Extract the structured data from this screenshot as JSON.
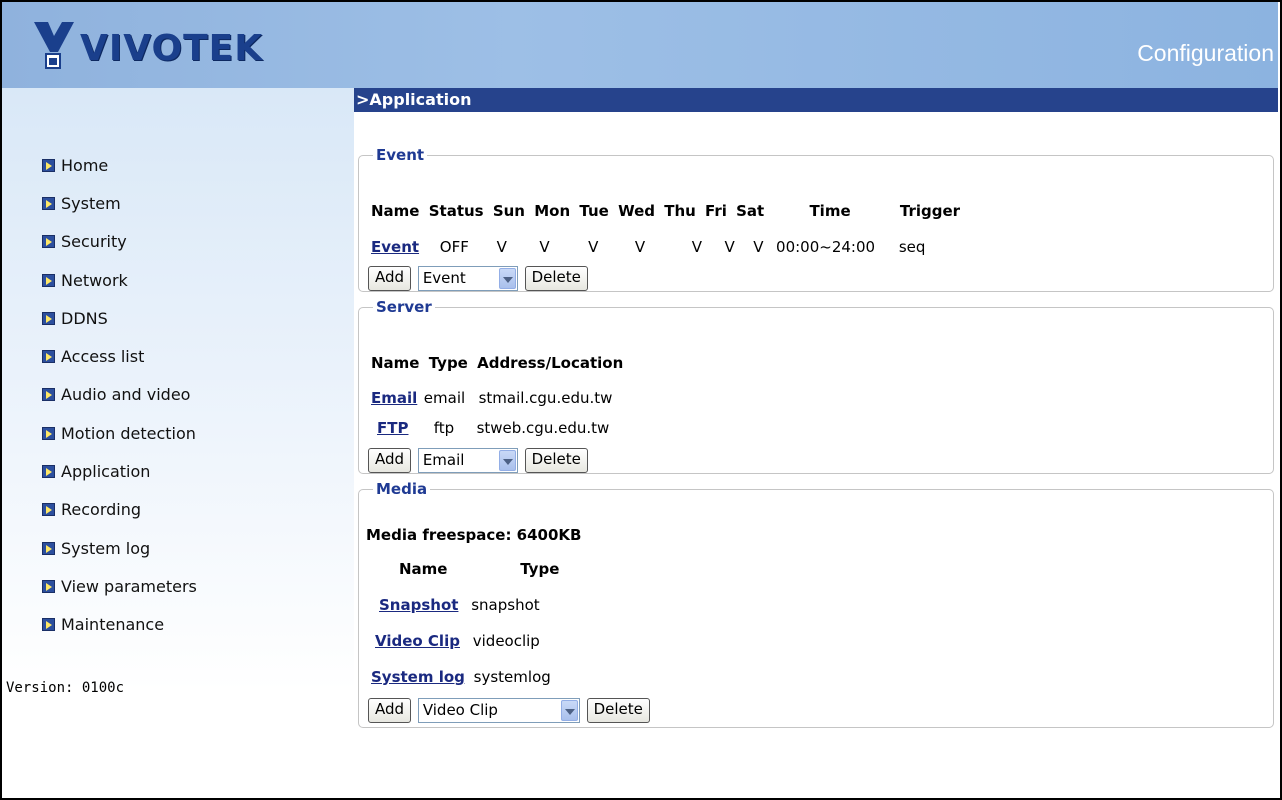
{
  "header": {
    "logo_text": "VIVOTEK",
    "title": "Configuration"
  },
  "sidebar": {
    "items": [
      {
        "label": "Home"
      },
      {
        "label": "System"
      },
      {
        "label": "Security"
      },
      {
        "label": "Network"
      },
      {
        "label": "DDNS"
      },
      {
        "label": "Access list"
      },
      {
        "label": "Audio and video"
      },
      {
        "label": "Motion detection"
      },
      {
        "label": "Application"
      },
      {
        "label": "Recording"
      },
      {
        "label": "System log"
      },
      {
        "label": "View parameters"
      },
      {
        "label": "Maintenance"
      }
    ],
    "version": "Version: 0100c"
  },
  "page": {
    "section_title": ">Application"
  },
  "event": {
    "legend": "Event",
    "columns": [
      "Name",
      "Status",
      "Sun",
      "Mon",
      "Tue",
      "Wed",
      "Thu",
      "Fri",
      "Sat",
      "Time",
      "Trigger"
    ],
    "rows": [
      {
        "name": "Event",
        "status": "OFF",
        "sun": "V",
        "mon": "V",
        "tue": "V",
        "wed": "V",
        "thu": "V",
        "fri": "V",
        "sat": "V",
        "time": "00:00~24:00",
        "trigger": "seq"
      }
    ],
    "add_label": "Add",
    "select_value": "Event",
    "delete_label": "Delete"
  },
  "server": {
    "legend": "Server",
    "columns": [
      "Name",
      "Type",
      "Address/Location"
    ],
    "rows": [
      {
        "name": "Email",
        "type": "email",
        "address": "stmail.cgu.edu.tw"
      },
      {
        "name": "FTP",
        "type": "ftp",
        "address": "stweb.cgu.edu.tw"
      }
    ],
    "add_label": "Add",
    "select_value": "Email",
    "delete_label": "Delete"
  },
  "media": {
    "legend": "Media",
    "freespace": "Media freespace: 6400KB",
    "columns": [
      "Name",
      "Type"
    ],
    "rows": [
      {
        "name": "Snapshot",
        "type": "snapshot"
      },
      {
        "name": "Video Clip",
        "type": "videoclip"
      },
      {
        "name": "System log",
        "type": "systemlog"
      }
    ],
    "add_label": "Add",
    "select_value": "Video Clip",
    "delete_label": "Delete"
  }
}
